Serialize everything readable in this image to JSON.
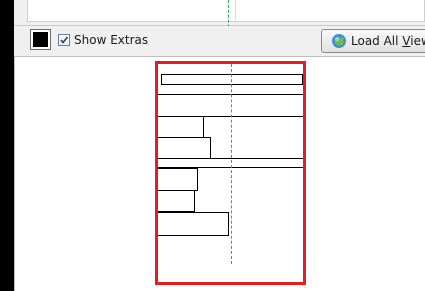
{
  "toolbar": {
    "show_extras_label": "Show Extras",
    "show_extras_checked": true,
    "load_button_label": "Load All ",
    "load_button_accel": "V",
    "load_button_rest": "iews"
  },
  "colors": {
    "frame_border": "#e81c1c",
    "guide_line": "#2eaa5c",
    "swatch": "#000000"
  }
}
